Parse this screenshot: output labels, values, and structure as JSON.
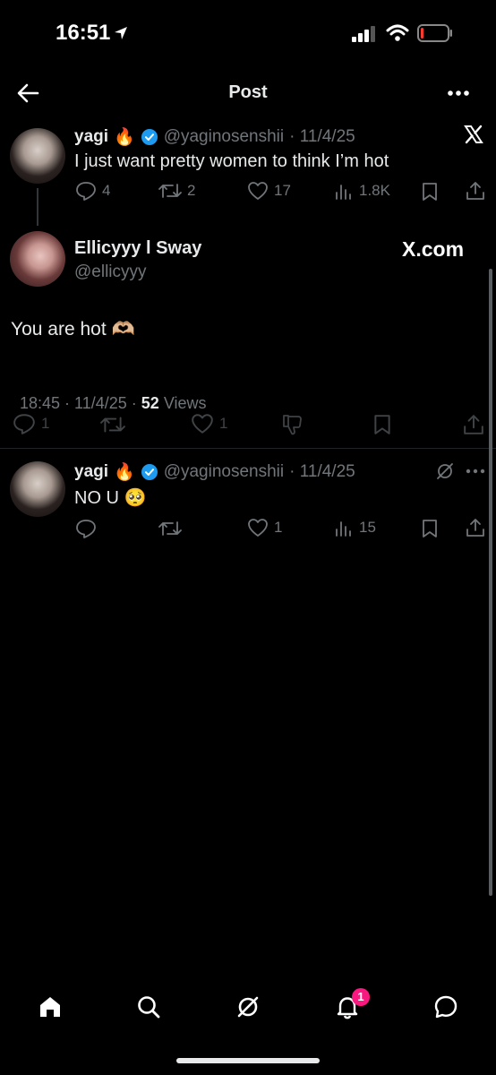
{
  "status_bar": {
    "time": "16:51"
  },
  "header": {
    "title": "Post"
  },
  "quoted_tweet": {
    "display_name": "yagi",
    "emoji": "🔥",
    "handle": "@yaginosenshii",
    "date": "· 11/4/25",
    "text": "I just want pretty women to think I’m hot",
    "replies": "4",
    "reposts": "2",
    "likes": "17",
    "views": "1.8K"
  },
  "main_post": {
    "display_name": "Ellicyyy l Sway",
    "handle": "@ellicyyy",
    "brand": "X.com",
    "text": "You are hot 🫶🏼",
    "timestamp": "18:45 · 11/4/25 · ",
    "views_count": "52",
    "views_label": " Views",
    "replies": "1",
    "likes": "1"
  },
  "reply_tweet": {
    "display_name": "yagi",
    "emoji": "🔥",
    "handle": "@yaginosenshii",
    "date": "· 11/4/25",
    "text": "NO U 🥺",
    "likes": "1",
    "views": "15"
  },
  "bottom_nav": {
    "notification_badge": "1"
  },
  "colors": {
    "background": "#000000",
    "verified": "#1d9bf0",
    "badge": "#f91880",
    "muted": "#71767b"
  }
}
